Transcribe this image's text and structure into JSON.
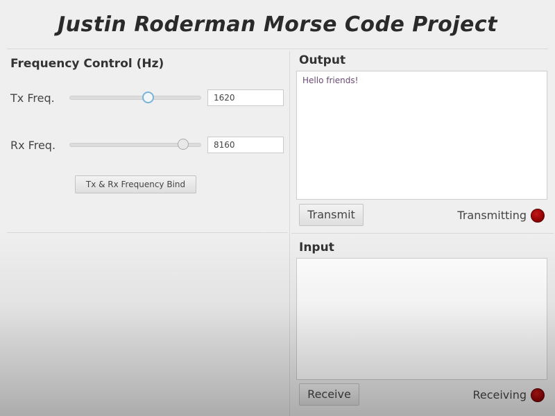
{
  "app": {
    "title": "Justin Roderman Morse Code Project"
  },
  "frequency_control": {
    "title": "Frequency Control (Hz)",
    "tx": {
      "label": "Tx Freq.",
      "value": "1620",
      "slider_fraction": 0.6
    },
    "rx": {
      "label": "Rx Freq.",
      "value": "8160",
      "slider_fraction": 0.87
    },
    "bind_button_label": "Tx & Rx Frequency Bind"
  },
  "output": {
    "title": "Output",
    "text": "Hello friends!",
    "transmit_button_label": "Transmit",
    "status_label": "Transmitting",
    "status_color": "#8c0000"
  },
  "input": {
    "title": "Input",
    "text": "",
    "receive_button_label": "Receive",
    "status_label": "Receiving",
    "status_color": "#8c0000"
  }
}
